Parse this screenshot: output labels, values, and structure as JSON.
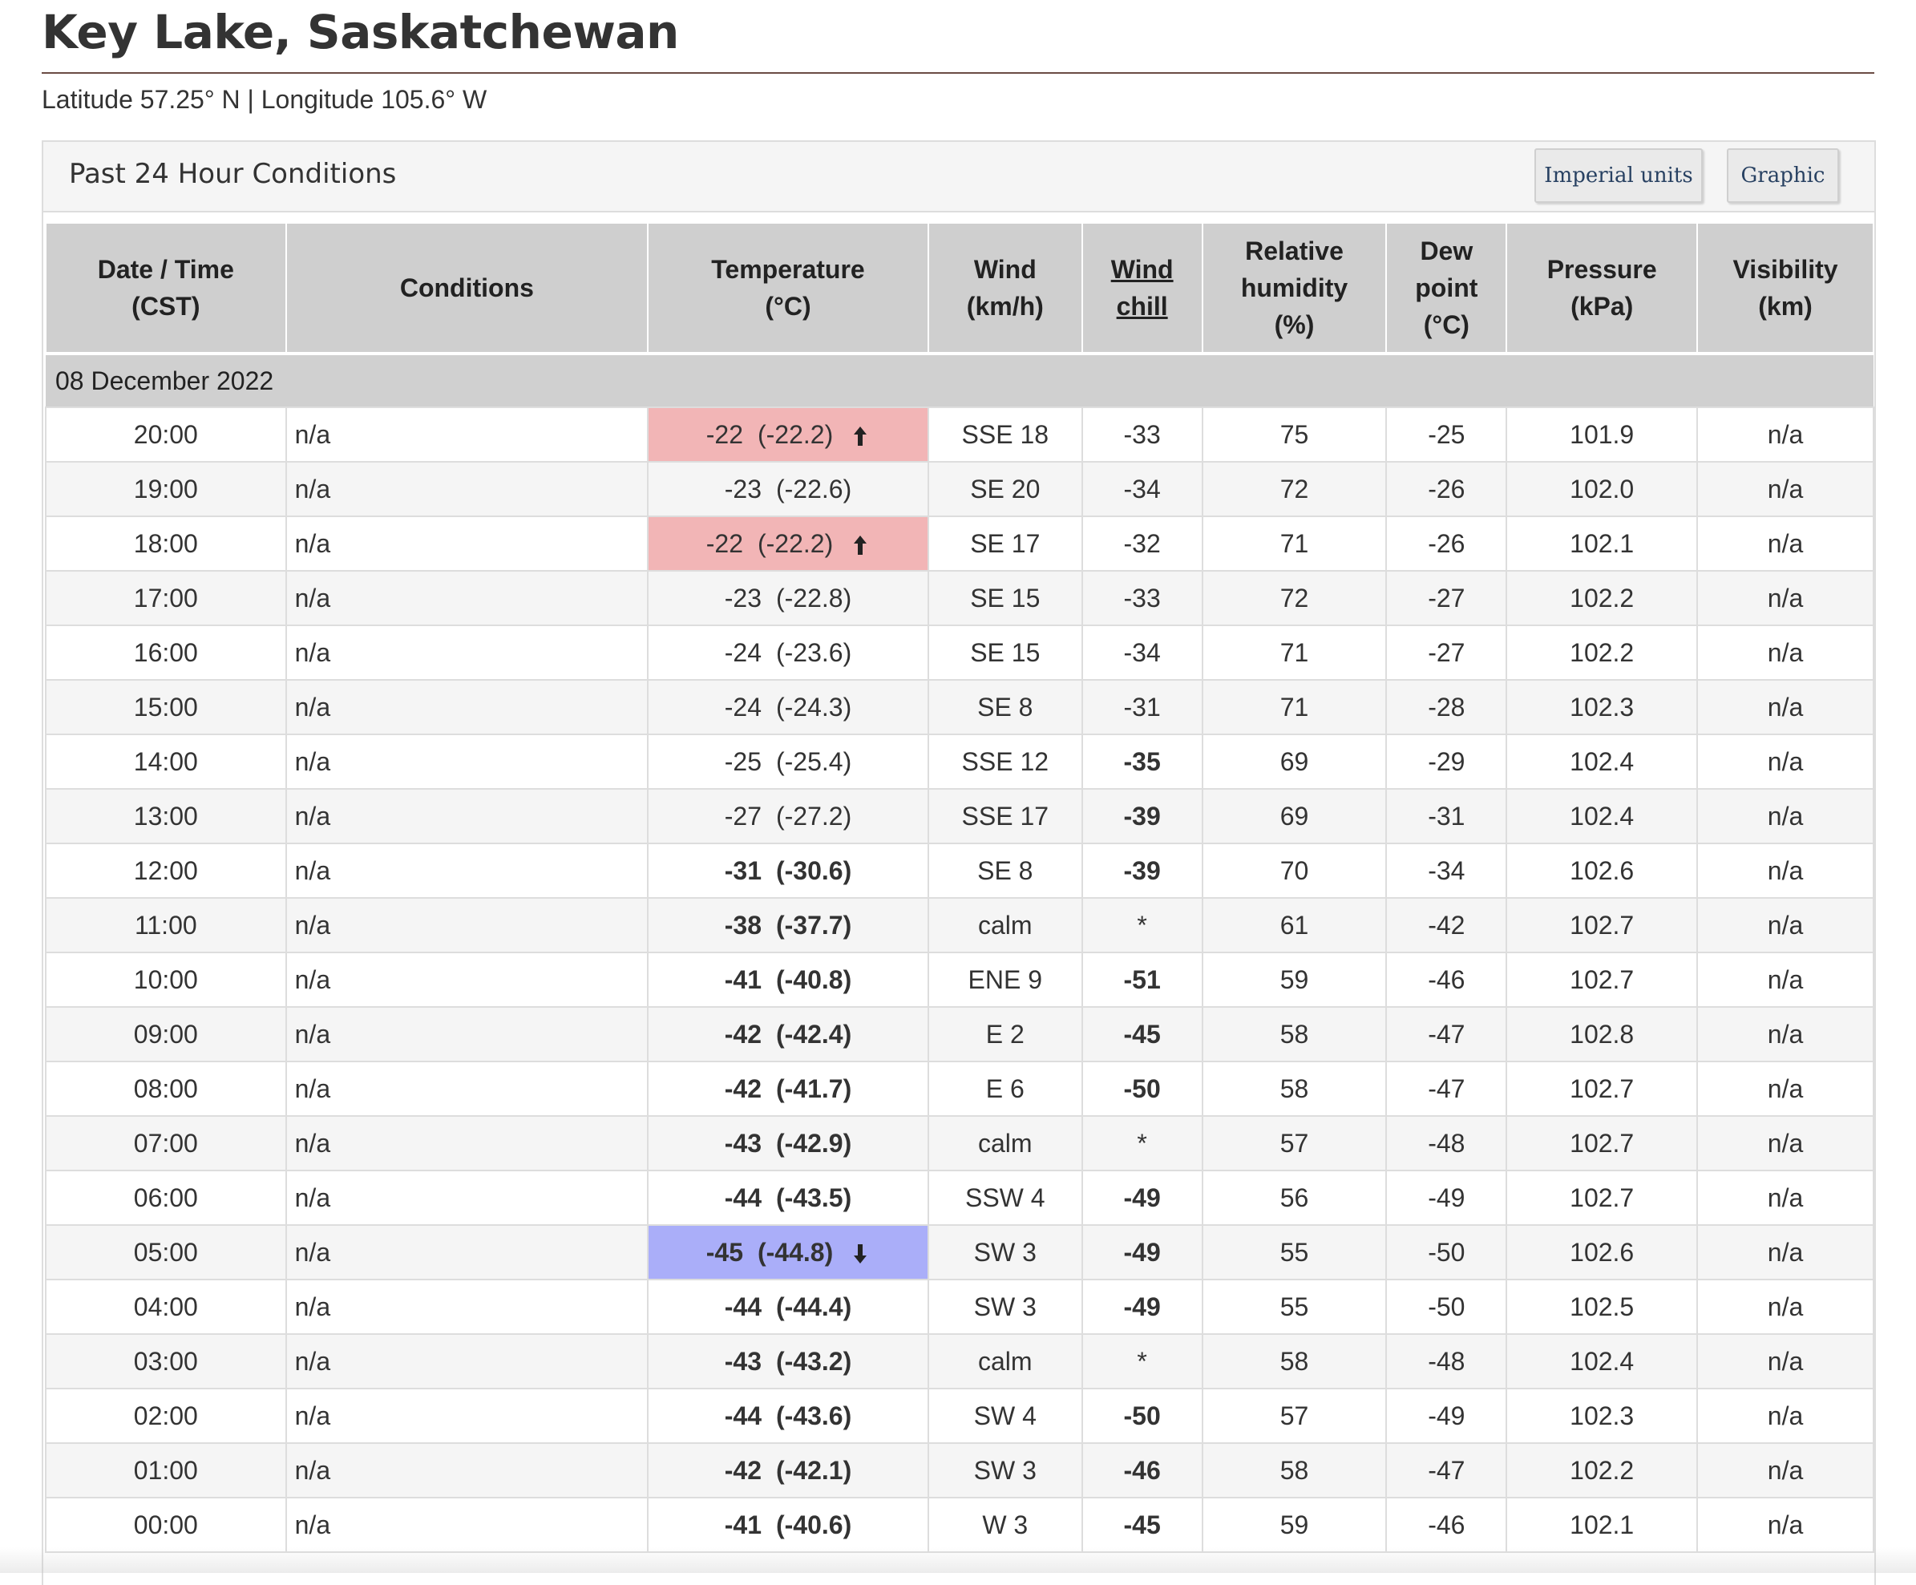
{
  "page": {
    "title": "Key Lake, Saskatchewan",
    "latlon": "Latitude 57.25° N | Longitude 105.6° W"
  },
  "panel": {
    "title": "Past 24 Hour Conditions",
    "buttons": {
      "imperial": "Imperial units",
      "graphic": "Graphic"
    }
  },
  "table": {
    "headers": {
      "datetime": [
        "Date / Time",
        "(CST)"
      ],
      "conditions": [
        "Conditions"
      ],
      "temperature": [
        "Temperature",
        "(°C)"
      ],
      "wind": [
        "Wind",
        "(km/h)"
      ],
      "windchill": [
        "Wind",
        "chill"
      ],
      "humidity": [
        "Relative",
        "humidity",
        "(%)"
      ],
      "dewpoint": [
        "Dew",
        "point",
        "(°C)"
      ],
      "pressure": [
        "Pressure",
        "(kPa)"
      ],
      "visibility": [
        "Visibility",
        "(km)"
      ]
    },
    "date_label": "08 December 2022",
    "colors": {
      "warm_highlight": "#f2b5b6",
      "cold_highlight": "#aaaef9"
    },
    "rows": [
      {
        "time": "20:00",
        "cond": "n/a",
        "temp": "-22",
        "temp_precise": "(-22.2)",
        "temp_bold": false,
        "highlight": "warm",
        "arrow": "up-arrow-icon",
        "wind": "SSE 18",
        "chill": "-33",
        "chill_bold": false,
        "rh": "75",
        "dew": "-25",
        "pres": "101.9",
        "vis": "n/a"
      },
      {
        "time": "19:00",
        "cond": "n/a",
        "temp": "-23",
        "temp_precise": "(-22.6)",
        "temp_bold": false,
        "highlight": "",
        "arrow": "",
        "wind": "SE 20",
        "chill": "-34",
        "chill_bold": false,
        "rh": "72",
        "dew": "-26",
        "pres": "102.0",
        "vis": "n/a"
      },
      {
        "time": "18:00",
        "cond": "n/a",
        "temp": "-22",
        "temp_precise": "(-22.2)",
        "temp_bold": false,
        "highlight": "warm",
        "arrow": "up-arrow-icon",
        "wind": "SE 17",
        "chill": "-32",
        "chill_bold": false,
        "rh": "71",
        "dew": "-26",
        "pres": "102.1",
        "vis": "n/a"
      },
      {
        "time": "17:00",
        "cond": "n/a",
        "temp": "-23",
        "temp_precise": "(-22.8)",
        "temp_bold": false,
        "highlight": "",
        "arrow": "",
        "wind": "SE 15",
        "chill": "-33",
        "chill_bold": false,
        "rh": "72",
        "dew": "-27",
        "pres": "102.2",
        "vis": "n/a"
      },
      {
        "time": "16:00",
        "cond": "n/a",
        "temp": "-24",
        "temp_precise": "(-23.6)",
        "temp_bold": false,
        "highlight": "",
        "arrow": "",
        "wind": "SE 15",
        "chill": "-34",
        "chill_bold": false,
        "rh": "71",
        "dew": "-27",
        "pres": "102.2",
        "vis": "n/a"
      },
      {
        "time": "15:00",
        "cond": "n/a",
        "temp": "-24",
        "temp_precise": "(-24.3)",
        "temp_bold": false,
        "highlight": "",
        "arrow": "",
        "wind": "SE 8",
        "chill": "-31",
        "chill_bold": false,
        "rh": "71",
        "dew": "-28",
        "pres": "102.3",
        "vis": "n/a"
      },
      {
        "time": "14:00",
        "cond": "n/a",
        "temp": "-25",
        "temp_precise": "(-25.4)",
        "temp_bold": false,
        "highlight": "",
        "arrow": "",
        "wind": "SSE 12",
        "chill": "-35",
        "chill_bold": true,
        "rh": "69",
        "dew": "-29",
        "pres": "102.4",
        "vis": "n/a"
      },
      {
        "time": "13:00",
        "cond": "n/a",
        "temp": "-27",
        "temp_precise": "(-27.2)",
        "temp_bold": false,
        "highlight": "",
        "arrow": "",
        "wind": "SSE 17",
        "chill": "-39",
        "chill_bold": true,
        "rh": "69",
        "dew": "-31",
        "pres": "102.4",
        "vis": "n/a"
      },
      {
        "time": "12:00",
        "cond": "n/a",
        "temp": "-31",
        "temp_precise": "(-30.6)",
        "temp_bold": true,
        "highlight": "",
        "arrow": "",
        "wind": "SE 8",
        "chill": "-39",
        "chill_bold": true,
        "rh": "70",
        "dew": "-34",
        "pres": "102.6",
        "vis": "n/a"
      },
      {
        "time": "11:00",
        "cond": "n/a",
        "temp": "-38",
        "temp_precise": "(-37.7)",
        "temp_bold": true,
        "highlight": "",
        "arrow": "",
        "wind": "calm",
        "chill": "*",
        "chill_bold": false,
        "rh": "61",
        "dew": "-42",
        "pres": "102.7",
        "vis": "n/a"
      },
      {
        "time": "10:00",
        "cond": "n/a",
        "temp": "-41",
        "temp_precise": "(-40.8)",
        "temp_bold": true,
        "highlight": "",
        "arrow": "",
        "wind": "ENE 9",
        "chill": "-51",
        "chill_bold": true,
        "rh": "59",
        "dew": "-46",
        "pres": "102.7",
        "vis": "n/a"
      },
      {
        "time": "09:00",
        "cond": "n/a",
        "temp": "-42",
        "temp_precise": "(-42.4)",
        "temp_bold": true,
        "highlight": "",
        "arrow": "",
        "wind": "E 2",
        "chill": "-45",
        "chill_bold": true,
        "rh": "58",
        "dew": "-47",
        "pres": "102.8",
        "vis": "n/a"
      },
      {
        "time": "08:00",
        "cond": "n/a",
        "temp": "-42",
        "temp_precise": "(-41.7)",
        "temp_bold": true,
        "highlight": "",
        "arrow": "",
        "wind": "E 6",
        "chill": "-50",
        "chill_bold": true,
        "rh": "58",
        "dew": "-47",
        "pres": "102.7",
        "vis": "n/a"
      },
      {
        "time": "07:00",
        "cond": "n/a",
        "temp": "-43",
        "temp_precise": "(-42.9)",
        "temp_bold": true,
        "highlight": "",
        "arrow": "",
        "wind": "calm",
        "chill": "*",
        "chill_bold": false,
        "rh": "57",
        "dew": "-48",
        "pres": "102.7",
        "vis": "n/a"
      },
      {
        "time": "06:00",
        "cond": "n/a",
        "temp": "-44",
        "temp_precise": "(-43.5)",
        "temp_bold": true,
        "highlight": "",
        "arrow": "",
        "wind": "SSW 4",
        "chill": "-49",
        "chill_bold": true,
        "rh": "56",
        "dew": "-49",
        "pres": "102.7",
        "vis": "n/a"
      },
      {
        "time": "05:00",
        "cond": "n/a",
        "temp": "-45",
        "temp_precise": "(-44.8)",
        "temp_bold": true,
        "highlight": "cold",
        "arrow": "down-arrow-icon",
        "wind": "SW 3",
        "chill": "-49",
        "chill_bold": true,
        "rh": "55",
        "dew": "-50",
        "pres": "102.6",
        "vis": "n/a"
      },
      {
        "time": "04:00",
        "cond": "n/a",
        "temp": "-44",
        "temp_precise": "(-44.4)",
        "temp_bold": true,
        "highlight": "",
        "arrow": "",
        "wind": "SW 3",
        "chill": "-49",
        "chill_bold": true,
        "rh": "55",
        "dew": "-50",
        "pres": "102.5",
        "vis": "n/a"
      },
      {
        "time": "03:00",
        "cond": "n/a",
        "temp": "-43",
        "temp_precise": "(-43.2)",
        "temp_bold": true,
        "highlight": "",
        "arrow": "",
        "wind": "calm",
        "chill": "*",
        "chill_bold": false,
        "rh": "58",
        "dew": "-48",
        "pres": "102.4",
        "vis": "n/a"
      },
      {
        "time": "02:00",
        "cond": "n/a",
        "temp": "-44",
        "temp_precise": "(-43.6)",
        "temp_bold": true,
        "highlight": "",
        "arrow": "",
        "wind": "SW 4",
        "chill": "-50",
        "chill_bold": true,
        "rh": "57",
        "dew": "-49",
        "pres": "102.3",
        "vis": "n/a"
      },
      {
        "time": "01:00",
        "cond": "n/a",
        "temp": "-42",
        "temp_precise": "(-42.1)",
        "temp_bold": true,
        "highlight": "",
        "arrow": "",
        "wind": "SW 3",
        "chill": "-46",
        "chill_bold": true,
        "rh": "58",
        "dew": "-47",
        "pres": "102.2",
        "vis": "n/a"
      },
      {
        "time": "00:00",
        "cond": "n/a",
        "temp": "-41",
        "temp_precise": "(-40.6)",
        "temp_bold": true,
        "highlight": "",
        "arrow": "",
        "wind": "W 3",
        "chill": "-45",
        "chill_bold": true,
        "rh": "59",
        "dew": "-46",
        "pres": "102.1",
        "vis": "n/a"
      }
    ]
  }
}
